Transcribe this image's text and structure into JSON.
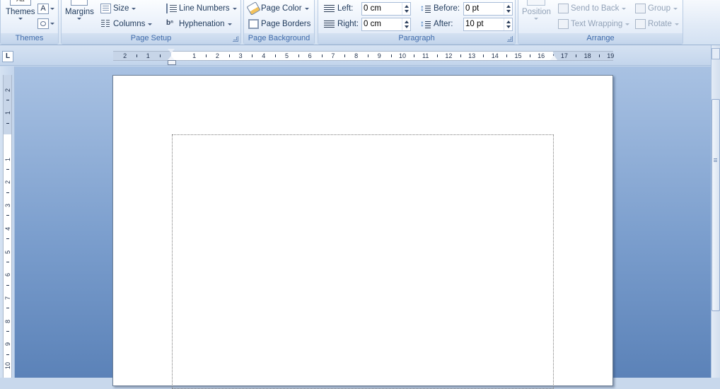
{
  "ribbon": {
    "themes": {
      "themes_label": "Themes",
      "caption": "Themes"
    },
    "page_setup": {
      "margins_label": "Margins",
      "size_label": "Size",
      "columns_label": "Columns",
      "line_numbers_label": "Line Numbers",
      "hyphenation_label": "Hyphenation",
      "caption": "Page Setup"
    },
    "page_background": {
      "page_color_label": "Page Color",
      "page_borders_label": "Page Borders",
      "caption": "Page Background"
    },
    "paragraph": {
      "indent_left_label": "Left:",
      "indent_left_value": "0 cm",
      "indent_right_label": "Right:",
      "indent_right_value": "0 cm",
      "spacing_before_label": "Before:",
      "spacing_before_value": "0 pt",
      "spacing_after_label": "After:",
      "spacing_after_value": "10 pt",
      "caption": "Paragraph"
    },
    "arrange": {
      "position_label": "Position",
      "send_to_back_label": "Send to Back",
      "text_wrapping_label": "Text Wrapping",
      "group_label": "Group",
      "rotate_label": "Rotate",
      "caption": "Arrange"
    }
  },
  "rulers": {
    "tab_selector_glyph": "L",
    "horizontal_marks": [
      "2",
      "1",
      "1",
      "2",
      "3",
      "4",
      "5",
      "6",
      "7",
      "8",
      "9",
      "10",
      "11",
      "12",
      "13",
      "14",
      "15",
      "16",
      "17",
      "18",
      "19"
    ],
    "vertical_marks": [
      "2",
      "1",
      "1",
      "2",
      "3",
      "4",
      "5",
      "6",
      "7",
      "8",
      "9",
      "10"
    ]
  },
  "colors": {
    "ribbon_text": "#1e395b",
    "caption_text": "#3e6aaa",
    "workspace_top": "#a9c2e3",
    "workspace_bottom": "#5b82b8"
  }
}
